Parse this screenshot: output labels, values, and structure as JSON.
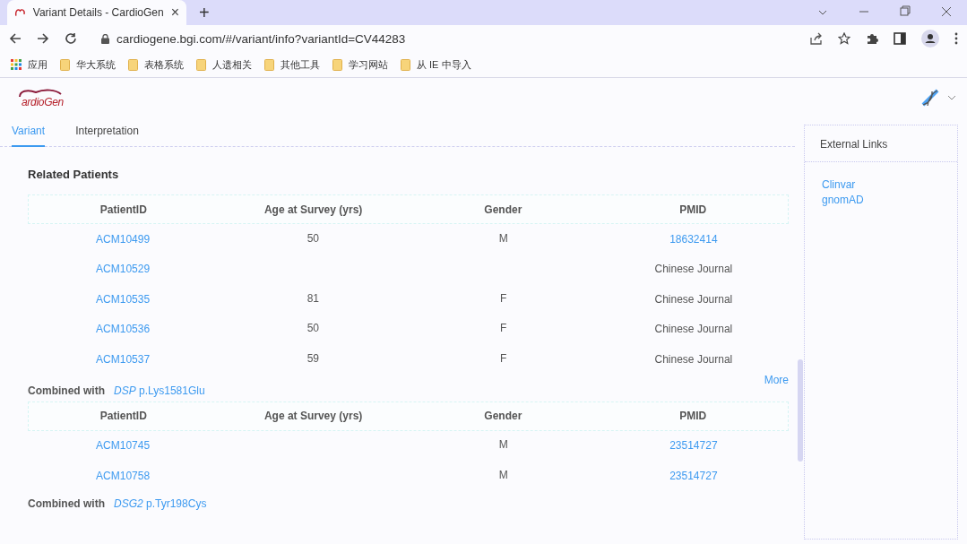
{
  "browser": {
    "tab_title": "Variant Details - CardioGen",
    "tab_close": "×",
    "new_tab": "+",
    "url": "cardiogene.bgi.com/#/variant/info?variantId=CV44283",
    "bookmarks": [
      {
        "label": "应用",
        "kind": "apps"
      },
      {
        "label": "华大系统",
        "kind": "folder"
      },
      {
        "label": "表格系统",
        "kind": "folder"
      },
      {
        "label": "人遗相关",
        "kind": "folder"
      },
      {
        "label": "其他工具",
        "kind": "folder"
      },
      {
        "label": "学习网站",
        "kind": "folder"
      },
      {
        "label": "从 IE 中导入",
        "kind": "folder"
      }
    ]
  },
  "header": {
    "logo_text": "ardioGen"
  },
  "tabs": [
    {
      "label": "Variant",
      "selected": true
    },
    {
      "label": "Interpretation",
      "selected": false
    }
  ],
  "related_patients": {
    "title": "Related Patients",
    "columns": [
      "PatientID",
      "Age at Survey (yrs)",
      "Gender",
      "PMID"
    ],
    "rows": [
      {
        "patient_id": "ACM10499",
        "age": "50",
        "gender": "M",
        "pmid": "18632414",
        "pmid_link": true
      },
      {
        "patient_id": "ACM10529",
        "pmid": "Chinese Journal",
        "pmid_link": false
      },
      {
        "patient_id": "ACM10535",
        "age": "81",
        "gender": "F",
        "pmid": "Chinese Journal",
        "pmid_link": false
      },
      {
        "patient_id": "ACM10536",
        "age": "50",
        "gender": "F",
        "pmid": "Chinese Journal",
        "pmid_link": false
      },
      {
        "patient_id": "ACM10537",
        "age": "59",
        "gender": "F",
        "pmid": "Chinese Journal",
        "pmid_link": false
      }
    ],
    "more": "More"
  },
  "combined": [
    {
      "label": "Combined with",
      "gene": "DSP",
      "change": "p.Lys1581Glu",
      "columns": [
        "PatientID",
        "Age at Survey (yrs)",
        "Gender",
        "PMID"
      ],
      "rows": [
        {
          "patient_id": "ACM10745",
          "gender": "M",
          "pmid": "23514727",
          "pmid_link": true
        },
        {
          "patient_id": "ACM10758",
          "gender": "M",
          "pmid": "23514727",
          "pmid_link": true
        }
      ]
    },
    {
      "label": "Combined with",
      "gene": "DSG2",
      "change": "p.Tyr198Cys"
    }
  ],
  "external_links": {
    "title": "External Links",
    "links": [
      "Clinvar",
      "gnomAD"
    ]
  }
}
